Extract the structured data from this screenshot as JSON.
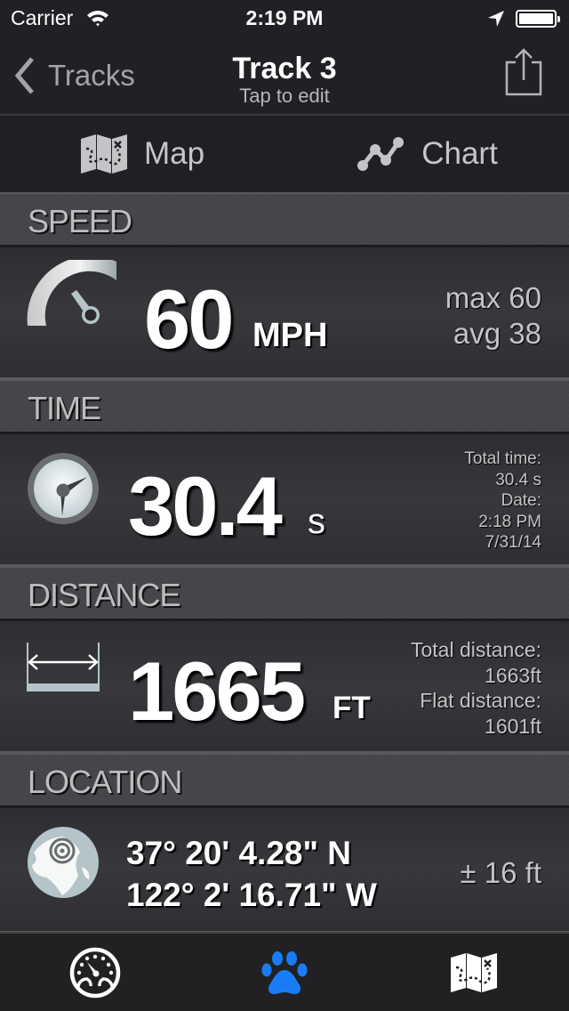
{
  "status_bar": {
    "carrier": "Carrier",
    "time": "2:19 PM",
    "icons": [
      "wifi-icon",
      "location-arrow-icon",
      "battery-icon"
    ],
    "battery_level": 1.0
  },
  "nav": {
    "back_label": "Tracks",
    "title": "Track 3",
    "subtitle": "Tap to edit",
    "share_icon": "share-icon"
  },
  "segments": [
    {
      "label": "Map",
      "icon": "map-icon"
    },
    {
      "label": "Chart",
      "icon": "line-chart-icon"
    }
  ],
  "speed": {
    "header": "SPEED",
    "icon": "speedometer-gauge-icon",
    "value": "60",
    "unit": "MPH",
    "max": "max 60",
    "avg": "avg 38"
  },
  "time": {
    "header": "TIME",
    "icon": "clock-icon",
    "value": "30.4",
    "unit": "s",
    "details": [
      "Total time:",
      "30.4 s",
      "Date:",
      "2:18 PM",
      "7/31/14"
    ]
  },
  "distance": {
    "header": "DISTANCE",
    "icon": "distance-ruler-icon",
    "value": "1665",
    "unit": "FT",
    "details": [
      "Total distance:",
      "1663ft",
      "Flat distance:",
      "1601ft"
    ]
  },
  "location": {
    "header": "LOCATION",
    "icon": "globe-icon",
    "lat": "37° 20' 4.28\" N",
    "lon": "122° 2' 16.71\" W",
    "accuracy": "± 16 ft"
  },
  "tabbar": {
    "active_color": "#1a7cf5",
    "tabs": [
      {
        "icon": "dashboard-gauge-icon",
        "active": false
      },
      {
        "icon": "paw-icon",
        "active": true
      },
      {
        "icon": "treasure-map-icon",
        "active": false
      }
    ]
  }
}
